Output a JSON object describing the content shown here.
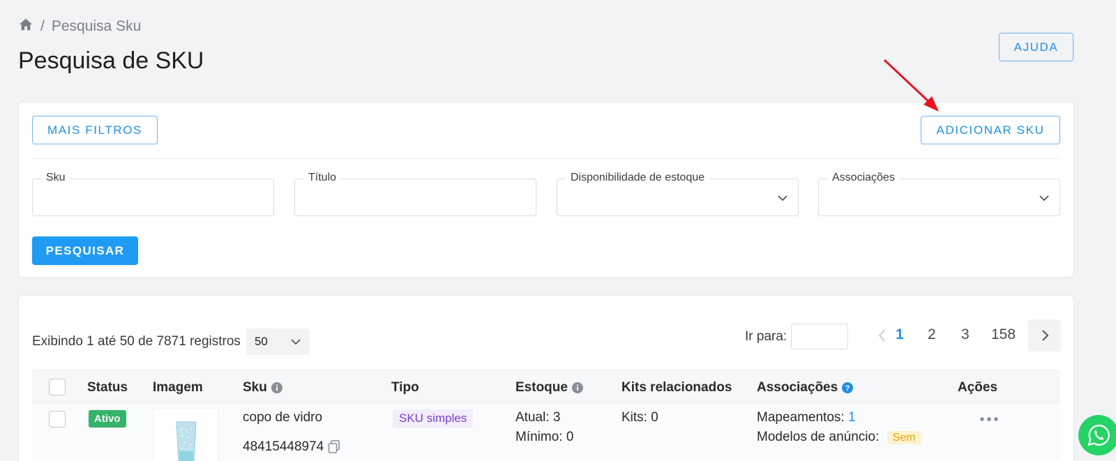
{
  "breadcrumb": {
    "separator": "/",
    "current": "Pesquisa Sku"
  },
  "page": {
    "title": "Pesquisa de SKU"
  },
  "header": {
    "help_label": "AJUDA"
  },
  "filters": {
    "more_filters_label": "MAIS FILTROS",
    "add_sku_label": "ADICIONAR SKU",
    "fields": [
      {
        "label": "Sku",
        "value": ""
      },
      {
        "label": "Título",
        "value": ""
      },
      {
        "label": "Disponibilidade de estoque",
        "value": ""
      },
      {
        "label": "Associações",
        "value": ""
      }
    ],
    "search_label": "PESQUISAR"
  },
  "table": {
    "records_text": "Exibindo 1 até 50 de 7871 registros",
    "per_page": "50",
    "goto_label": "Ir para:",
    "pages": [
      "1",
      "2",
      "3",
      "158"
    ],
    "current_page": "1",
    "columns": [
      "Status",
      "Imagem",
      "Sku",
      "Tipo",
      "Estoque",
      "Kits relacionados",
      "Associações",
      "Ações"
    ],
    "rows": [
      {
        "status": "Ativo",
        "name": "copo de vidro",
        "sku": "48415448974",
        "type": "SKU simples",
        "stock_current": "Atual: 3",
        "stock_min": "Mínimo: 0",
        "kits": "Kits: 0",
        "mappings_label": "Mapeamentos:",
        "mappings_value": "1",
        "ad_models_label": "Modelos de anúncio:",
        "ad_models_value": "Sem"
      }
    ]
  },
  "colors": {
    "accent": "#1f9bf4",
    "success": "#34b36a",
    "purple": "#7b3fd1",
    "warning": "#e0a800",
    "annotation": "#e8141c"
  }
}
